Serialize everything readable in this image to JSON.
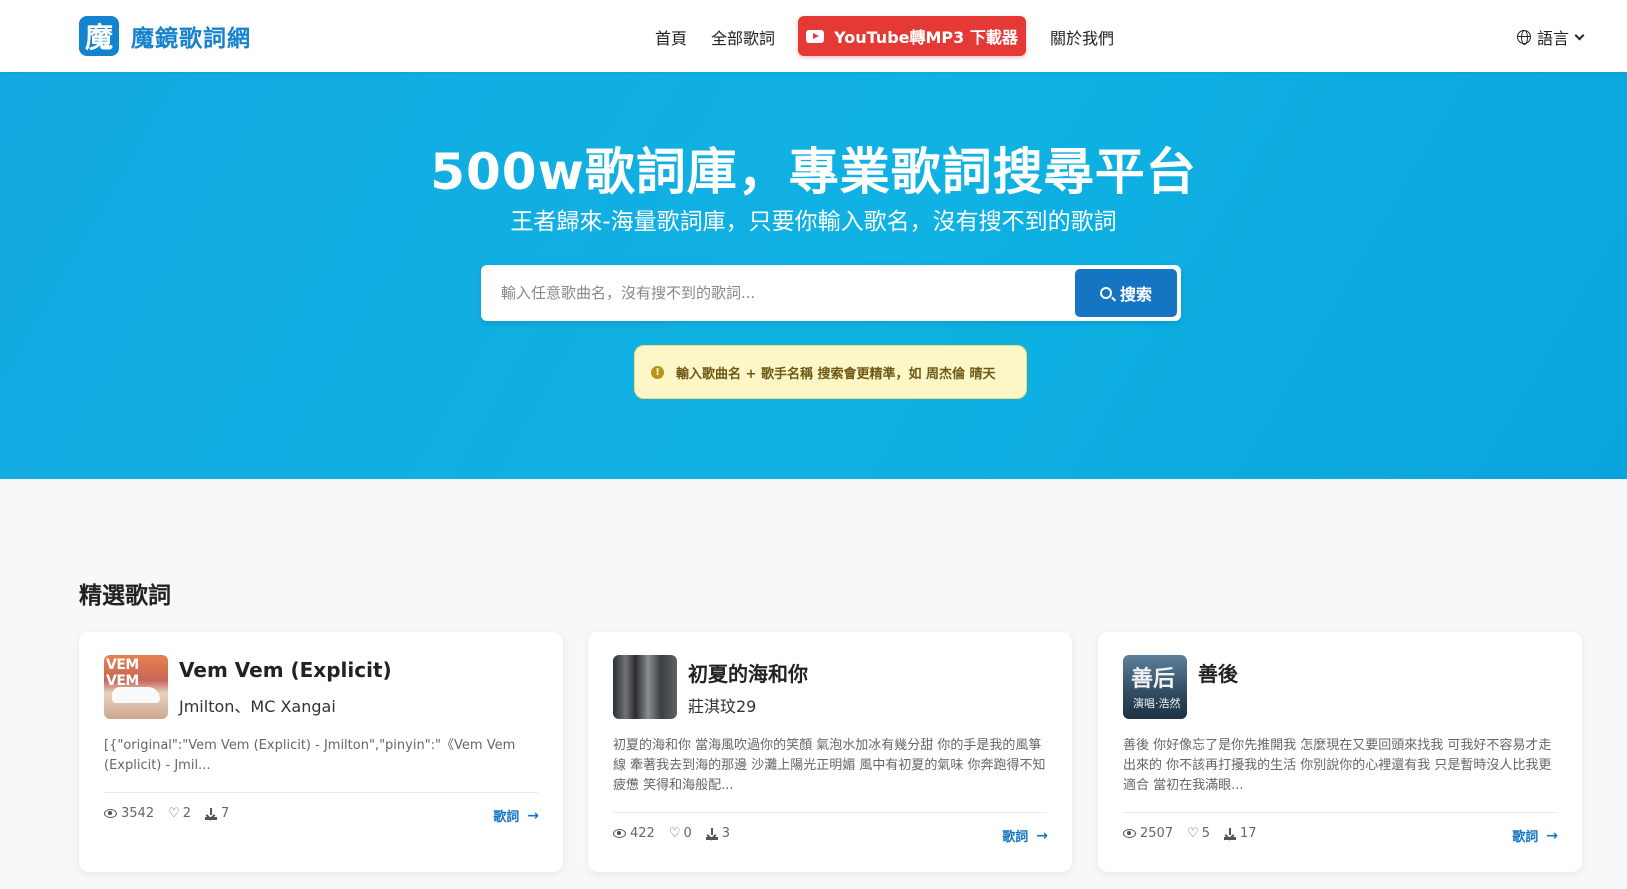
{
  "brand": {
    "logo_char": "魔",
    "name": "魔鏡歌詞網"
  },
  "nav": {
    "home": "首頁",
    "all_lyrics": "全部歌詞",
    "yt_button": "YouTube轉MP3 下載器",
    "about": "關於我們",
    "language": "語言"
  },
  "hero": {
    "title": "500w歌詞庫，專業歌詞搜尋平台",
    "subtitle": "王者歸來-海量歌詞庫，只要你輸入歌名，沒有搜不到的歌詞",
    "search_placeholder": "輸入任意歌曲名，沒有搜不到的歌詞...",
    "search_button": "搜索",
    "tip": "輸入歌曲名 + 歌手名稱 搜索會更精準，如 周杰倫 晴天"
  },
  "featured": {
    "title": "精選歌詞",
    "cards": [
      {
        "title": "Vem Vem (Explicit)",
        "artist": "Jmilton、MC Xangai",
        "cover_text": "VEM VEM",
        "excerpt": "[{\"original\":\"Vem Vem (Explicit) - Jmilton\",\"pinyin\":\"《Vem Vem (Explicit) - Jmil...",
        "views": "3542",
        "likes": "2",
        "downloads": "7",
        "link": "歌詞"
      },
      {
        "title": "初夏的海和你",
        "artist": "莊淇玟29",
        "excerpt": "初夏的海和你 當海風吹過你的笑顏 氣泡水加冰有幾分甜 你的手是我的風箏線 牽著我去到海的那邊 沙灘上陽光正明媚 風中有初夏的氣味 你奔跑得不知疲憊 笑得和海般配...",
        "views": "422",
        "likes": "0",
        "downloads": "3",
        "link": "歌詞"
      },
      {
        "title": "善後",
        "artist": "",
        "cover_text_1": "善后",
        "cover_text_2": "演唱·浩然",
        "excerpt": "善後 你好像忘了是你先推開我 怎麼現在又要回頭來找我 可我好不容易才走出來的 你不該再打擾我的生活 你別說你的心裡還有我 只是暫時沒人比我更適合 當初在我滿眼...",
        "views": "2507",
        "likes": "5",
        "downloads": "17",
        "link": "歌詞"
      }
    ]
  },
  "colors": {
    "primary": "#1575c2",
    "hero": "#14a9e0",
    "youtube": "#e53935",
    "tip_bg": "#fdf6c6"
  }
}
